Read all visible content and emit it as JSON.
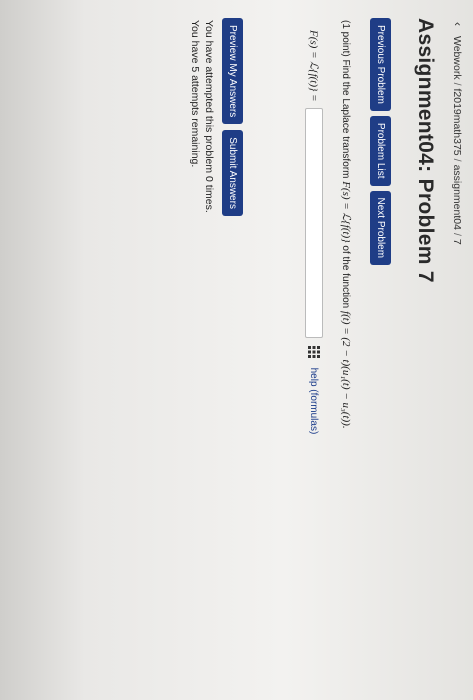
{
  "breadcrumb": {
    "back_icon": "‹",
    "part1": "Webwork",
    "separator": "/",
    "part2": "f2019math375",
    "part3": "assignment04",
    "part4": "7"
  },
  "title": "Assignment04: Problem 7",
  "nav": {
    "previous": "Previous Problem",
    "list": "Problem List",
    "next": "Next Problem"
  },
  "problem": {
    "points": "(1 point)",
    "text": "Find the Laplace transform",
    "lhs": "F(s) = ℒ{f(t)}",
    "middle": "of the function",
    "function": "f(t) = (2 − t)(u₁(t) − u₃(t))."
  },
  "answer": {
    "label": "F(s) = ℒ{f(t)} =",
    "value": "",
    "placeholder": "",
    "grid_icon": "grid-icon",
    "help_link": "help (formulas)"
  },
  "actions": {
    "preview": "Preview My Answers",
    "submit": "Submit Answers"
  },
  "status": {
    "attempted": "You have attempted this problem 0 times.",
    "remaining": "You have 5 attempts remaining."
  },
  "colors": {
    "button": "#1f3d86",
    "link": "#1a3b8a"
  }
}
